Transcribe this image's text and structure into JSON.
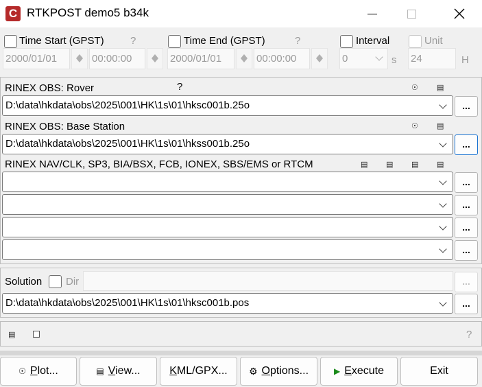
{
  "window": {
    "title": "RTKPOST demo5 b34k"
  },
  "time": {
    "start_label": "Time Start (GPST)",
    "start_help": "?",
    "start_date": "2000/01/01",
    "start_time": "00:00:00",
    "end_label": "Time End (GPST)",
    "end_help": "?",
    "end_date": "2000/01/01",
    "end_time": "00:00:00",
    "interval_label": "Interval",
    "interval_value": "0",
    "interval_unit": "s",
    "unit_label": "Unit",
    "unit_value": "24",
    "unit_suffix": "H"
  },
  "inputs": {
    "rover_label": "RINEX OBS: Rover",
    "rover_help": "?",
    "rover_path": "D:\\data\\hkdata\\obs\\2025\\001\\HK\\1s\\01\\hksc001b.25o",
    "base_label": "RINEX OBS: Base Station",
    "base_path": "D:\\data\\hkdata\\obs\\2025\\001\\HK\\1s\\01\\hkss001b.25o",
    "nav_label": "RINEX NAV/CLK, SP3, BIA/BSX, FCB, IONEX, SBS/EMS  or RTCM",
    "browse": "..."
  },
  "solution": {
    "label": "Solution",
    "dir_label": "Dir",
    "path": "D:\\data\\hkdata\\obs\\2025\\001\\HK\\1s\\01\\hksc001b.pos",
    "browse": "..."
  },
  "status": {
    "help": "?"
  },
  "buttons": {
    "plot": "Plot...",
    "view": "View...",
    "kml": "KML/GPX...",
    "options": "Options...",
    "execute": "Execute",
    "exit": "Exit"
  }
}
